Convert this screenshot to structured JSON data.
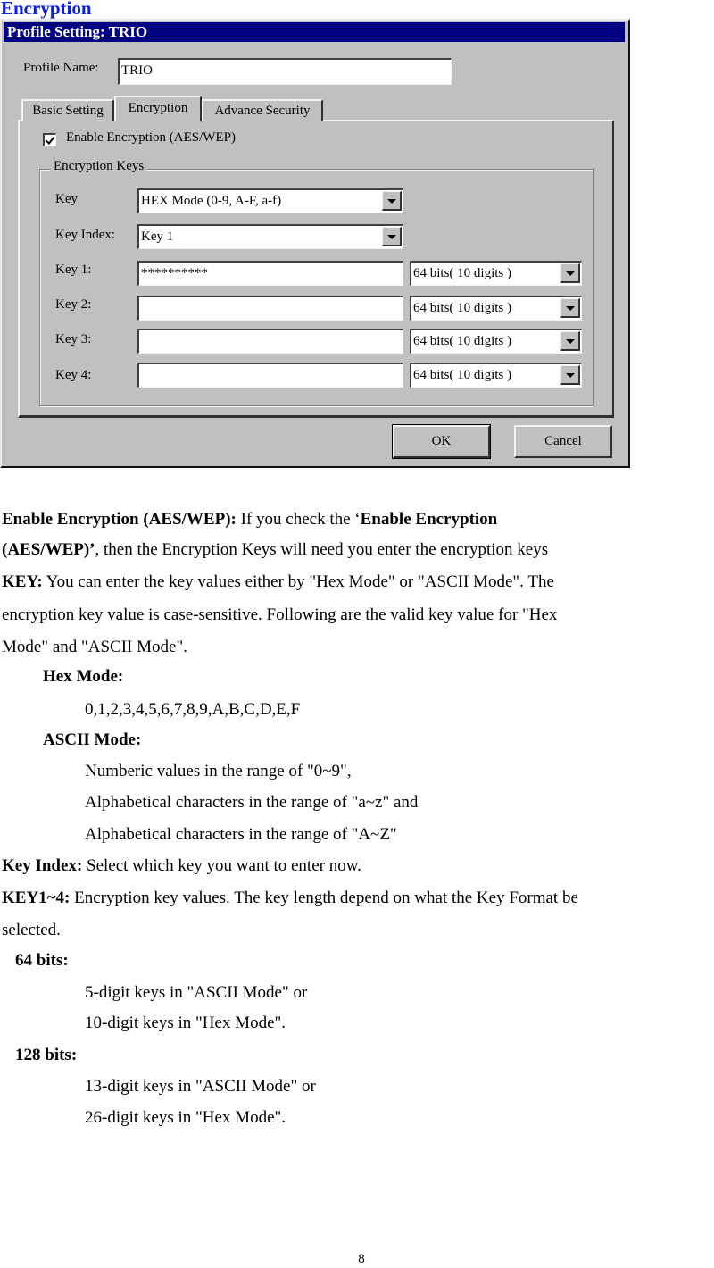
{
  "section_title": "Encryption",
  "dialog": {
    "title": "Profile Setting: TRIO",
    "profile_name_label": "Profile Name:",
    "profile_name_value": "TRIO",
    "tabs": [
      {
        "label": "Basic Setting",
        "active": false
      },
      {
        "label": "Encryption",
        "active": true
      },
      {
        "label": "Advance Security",
        "active": false
      }
    ],
    "enable_encryption": {
      "label": "Enable Encryption (AES/WEP)",
      "checked": true
    },
    "group_title": "Encryption Keys",
    "key_mode": {
      "label": "Key",
      "value": "HEX Mode (0-9, A-F, a-f)"
    },
    "key_index": {
      "label": "Key Index:",
      "value": "Key 1"
    },
    "keys": [
      {
        "label": "Key 1:",
        "value": "**********",
        "length": "64 bits( 10 digits )"
      },
      {
        "label": "Key 2:",
        "value": "",
        "length": "64 bits( 10 digits )"
      },
      {
        "label": "Key 3:",
        "value": "",
        "length": "64 bits( 10 digits )"
      },
      {
        "label": "Key 4:",
        "value": "",
        "length": "64 bits( 10 digits )"
      }
    ],
    "ok_label": "OK",
    "cancel_label": "Cancel"
  },
  "body": {
    "enable_term": "Enable Encryption (AES/WEP):",
    "enable_text1": " If you check the ‘",
    "enable_term2": "Enable Encryption",
    "enable_term3": "(AES/WEP)’",
    "enable_text2": ", then the Encryption Keys will need you enter the encryption keys",
    "key_term": "KEY:",
    "key_text1": " You can enter the key values either by \"Hex Mode\" or \"ASCII Mode\". The",
    "key_text2": "encryption key value is case-sensitive. Following are the valid key value for \"Hex",
    "key_text3": "Mode\" and \"ASCII Mode\".",
    "hex_heading": "Hex Mode:",
    "hex_values": "0,1,2,3,4,5,6,7,8,9,A,B,C,D,E,F",
    "ascii_heading": "ASCII Mode:",
    "ascii_lines": [
      "Numberic values in the range of \"0~9\",",
      "Alphabetical characters in the range of \"a~z\" and",
      "Alphabetical characters in the range of \"A~Z\""
    ],
    "key_index_term": "Key Index:",
    "key_index_text": " Select which key you want to enter now.",
    "key14_term": "KEY1~4:",
    "key14_text1": " Encryption key values. The key length depend on what the Key Format be",
    "key14_text2": "selected.",
    "bits64_heading": "64 bits:",
    "bits64_lines": [
      "5-digit keys in \"ASCII Mode\" or",
      "10-digit keys in \"Hex Mode\"."
    ],
    "bits128_heading": "128 bits:",
    "bits128_lines": [
      "13-digit keys in \"ASCII Mode\" or",
      "26-digit keys in \"Hex Mode\"."
    ]
  },
  "page_number": "8"
}
